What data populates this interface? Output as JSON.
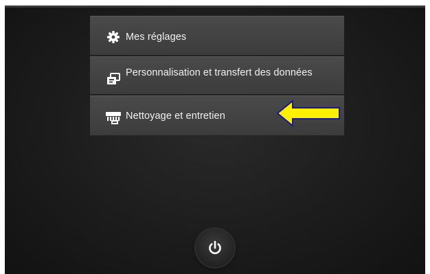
{
  "menu": {
    "items": [
      {
        "label": "Mes réglages",
        "icon": "gear-icon"
      },
      {
        "label": "Personnalisation et transfert des données",
        "icon": "transfer-icon"
      },
      {
        "label": "Nettoyage et entretien",
        "icon": "cleaning-icon"
      }
    ]
  },
  "annotation": {
    "icon": "yellow-arrow-pointer",
    "color": "#ffef00"
  },
  "power": {
    "icon": "power-icon"
  },
  "colors": {
    "menu_bg": "#444444",
    "text": "#f2f2f2",
    "screen_bg": "#1c1c1c"
  }
}
